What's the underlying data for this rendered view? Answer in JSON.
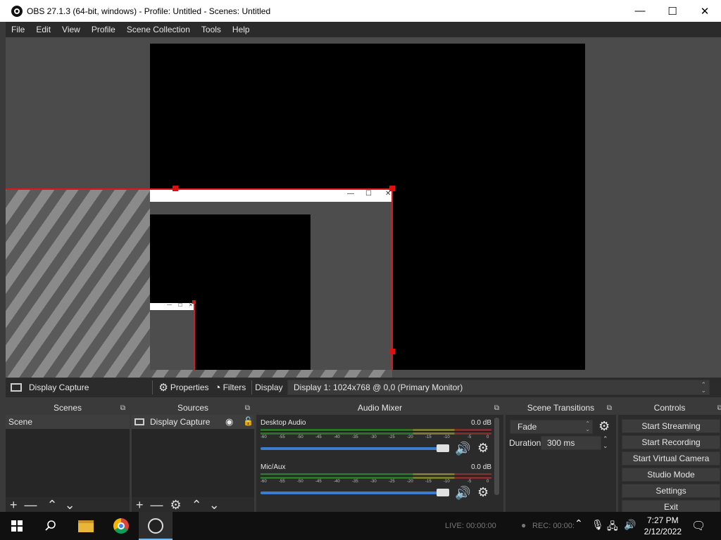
{
  "window": {
    "title": "OBS 27.1.3 (64-bit, windows) - Profile: Untitled - Scenes: Untitled",
    "minimize": "—",
    "maximize": "☐",
    "close": "✕"
  },
  "menu": [
    "File",
    "Edit",
    "View",
    "Profile",
    "Scene Collection",
    "Tools",
    "Help"
  ],
  "source_toolbar": {
    "source_name": "Display Capture",
    "properties": "Properties",
    "filters": "Filters",
    "display_label": "Display",
    "display_value": "Display 1: 1024x768 @ 0,0 (Primary Monitor)"
  },
  "scenes": {
    "title": "Scenes",
    "items": [
      "Scene"
    ]
  },
  "sources": {
    "title": "Sources",
    "items": [
      "Display Capture"
    ]
  },
  "mixer": {
    "title": "Audio Mixer",
    "scale": [
      "-60",
      "-55",
      "-50",
      "-45",
      "-40",
      "-35",
      "-30",
      "-25",
      "-20",
      "-15",
      "-10",
      "-5",
      "0"
    ],
    "channels": [
      {
        "name": "Desktop Audio",
        "db": "0.0 dB",
        "volume": 1.0
      },
      {
        "name": "Mic/Aux",
        "db": "0.0 dB",
        "volume": 1.0
      }
    ]
  },
  "transitions": {
    "title": "Scene Transitions",
    "transition": "Fade",
    "duration_label": "Duration",
    "duration_value": "300 ms"
  },
  "controls": {
    "title": "Controls",
    "buttons": [
      "Start Streaming",
      "Start Recording",
      "Start Virtual Camera",
      "Studio Mode",
      "Settings",
      "Exit"
    ]
  },
  "statusbar": {
    "live": "LIVE: 00:00:00",
    "rec": "REC: 00:00:"
  },
  "taskbar": {
    "time": "7:27 PM",
    "date": "2/12/2022"
  },
  "icons": {
    "app": "obs-icon",
    "monitor": "monitor-icon",
    "gear": "⚙",
    "filters": "filter-icon",
    "eye": "eye-icon",
    "lock": "lock-icon",
    "add": "+",
    "remove": "—",
    "up": "⌃",
    "down": "⌄",
    "speaker": "🔊"
  },
  "colors": {
    "selection_red": "#d91a1a",
    "fader_blue": "#3d7ccc"
  }
}
